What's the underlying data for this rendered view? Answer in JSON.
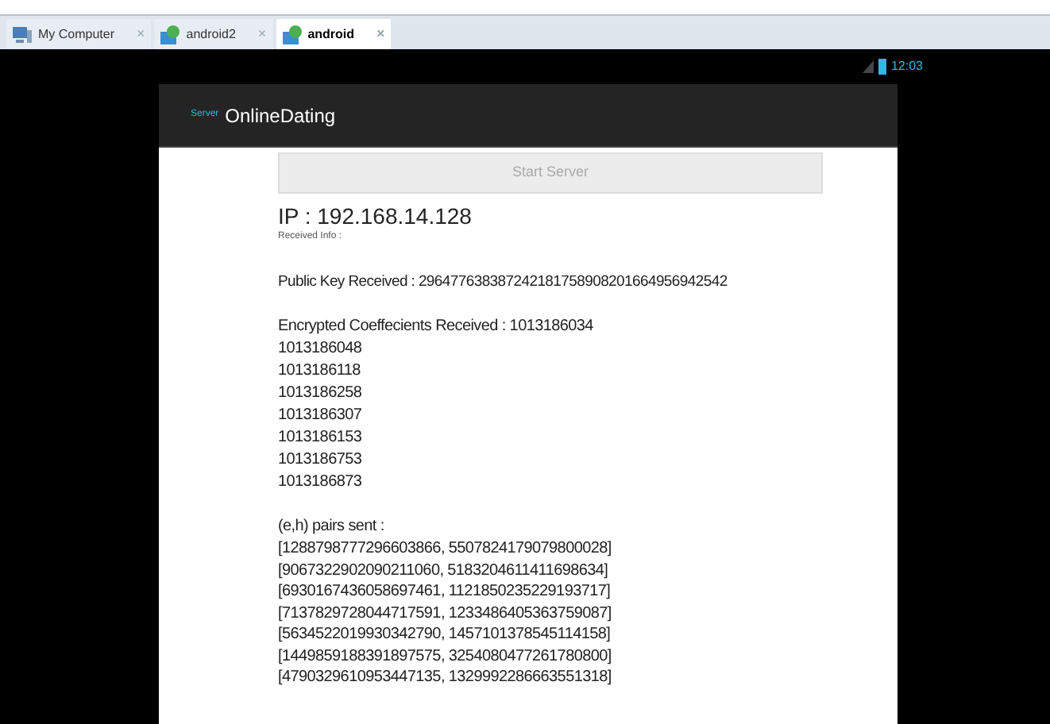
{
  "tabs": [
    {
      "label": "My Computer",
      "kind": "computer",
      "close": "×",
      "selected": false
    },
    {
      "label": "android2",
      "kind": "vm",
      "close": "×",
      "selected": false
    },
    {
      "label": "android",
      "kind": "vm",
      "close": "×",
      "selected": true
    }
  ],
  "status_bar": {
    "time": "12:03"
  },
  "action_bar": {
    "subtitle": "Server",
    "title": "OnlineDating"
  },
  "start_button": {
    "label": "Start Server",
    "disabled": true
  },
  "ip": "IP : 192.168.14.128",
  "received_info": "Received Info :",
  "public_key": "Public Key Received : 296477638387242181758908201664956942542",
  "coefficients": [
    "Encrypted Coeffecients Received : 1013186034",
    "1013186048",
    "1013186118",
    "1013186258",
    "1013186307",
    "1013186153",
    "1013186753",
    "1013186873"
  ],
  "pairs_heading": "(e,h) pairs sent :",
  "pairs": [
    "[1288798777296603866, 5507824179079800028]",
    "[9067322902090211060, 5183204611411698634]",
    "[6930167436058697461, 1121850235229193717]",
    "[7137829728044717591, 1233486405363759087]",
    "[5634522019930342790, 1457101378545114158]",
    "[1449859188391897575, 3254080477261780800]",
    "[4790329610953447135, 1329992286663551318]"
  ]
}
